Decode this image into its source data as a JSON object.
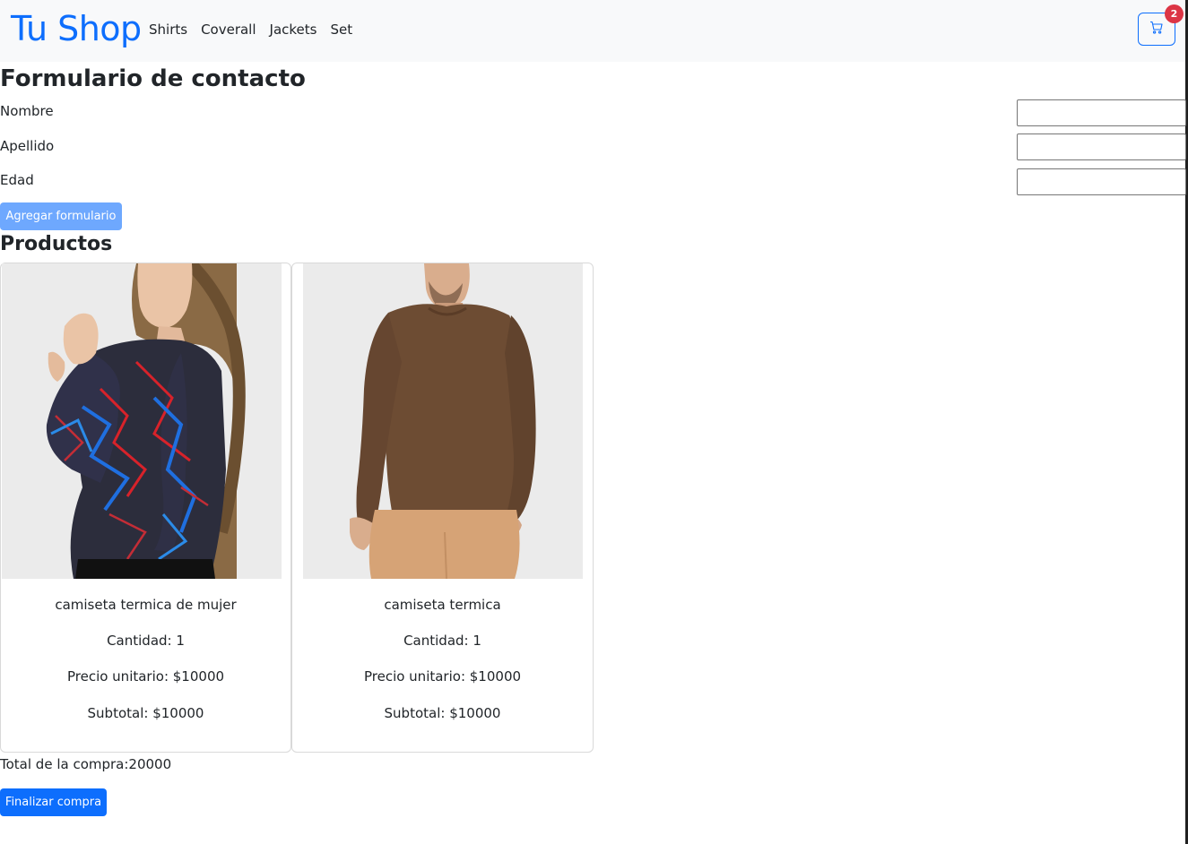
{
  "navbar": {
    "brand": "Tu Shop",
    "links": [
      "Shirts",
      "Coverall",
      "Jackets",
      "Set"
    ],
    "cart": {
      "icon": "cart-icon",
      "count": "2"
    }
  },
  "form": {
    "title": "Formulario de contacto",
    "fields": [
      {
        "label": "Nombre",
        "value": ""
      },
      {
        "label": "Apellido",
        "value": ""
      },
      {
        "label": "Edad",
        "value": ""
      }
    ],
    "submit_label": "Agregar formulario"
  },
  "products": {
    "title": "Productos",
    "items": [
      {
        "name": "camiseta termica de mujer",
        "quantity": "Cantidad: 1",
        "unit_price": "Precio unitario: $10000",
        "subtotal": "Subtotal: $10000"
      },
      {
        "name": "camiseta termica",
        "quantity": "Cantidad: 1",
        "unit_price": "Precio unitario: $10000",
        "subtotal": "Subtotal: $10000"
      }
    ]
  },
  "total": "Total de la compra:20000",
  "finish_label": "Finalizar compra",
  "colors": {
    "primary": "#0d6efd",
    "primary_disabled": "#6ea8fe",
    "badge": "#dc3545",
    "navbar_bg": "#f8f9fa"
  }
}
